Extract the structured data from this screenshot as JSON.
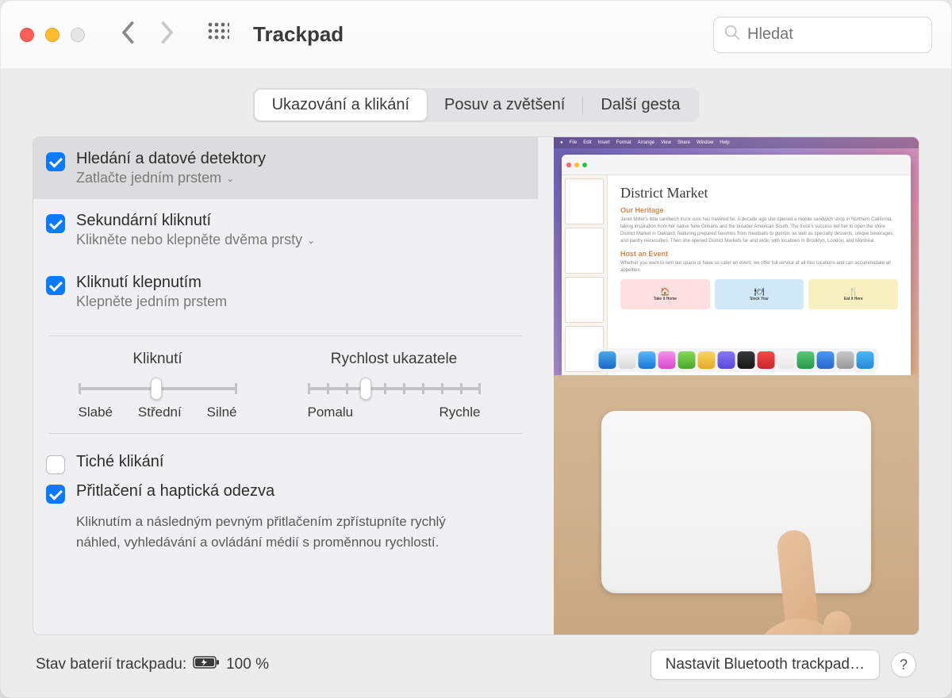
{
  "window": {
    "title": "Trackpad"
  },
  "search": {
    "placeholder": "Hledat"
  },
  "tabs": {
    "point_click": "Ukazování a klikání",
    "scroll_zoom": "Posuv a zvětšení",
    "more_gestures": "Další gesta"
  },
  "options": {
    "lookup": {
      "title": "Hledání a datové detektory",
      "sub": "Zatlačte jedním prstem"
    },
    "secondary": {
      "title": "Sekundární kliknutí",
      "sub": "Klikněte nebo klepněte dvěma prsty"
    },
    "tap": {
      "title": "Kliknutí klepnutím",
      "sub": "Klepněte jedním prstem"
    }
  },
  "sliders": {
    "click": {
      "label": "Kliknutí",
      "left": "Slabé",
      "mid": "Střední",
      "right": "Silné"
    },
    "tracking": {
      "label": "Rychlost ukazatele",
      "left": "Pomalu",
      "right": "Rychle"
    }
  },
  "silent": {
    "label": "Tiché klikání"
  },
  "force": {
    "label": "Přitlačení a haptická odezva",
    "desc": "Kliknutím a následným pevným přitlačením zpřístupníte rychlý náhled, vyhledávání a ovládání médií s proměnnou rychlostí."
  },
  "footer": {
    "battery_label": "Stav baterií trackpadu:",
    "battery_value": "100 %",
    "bluetooth_btn": "Nastavit Bluetooth trackpad…"
  },
  "preview": {
    "doc_title": "District Market",
    "h_heritage": "Our Heritage",
    "h_event": "Host an Event",
    "card1": "Take It Home",
    "card2": "Stock Your",
    "card3": "Eat It Here"
  }
}
